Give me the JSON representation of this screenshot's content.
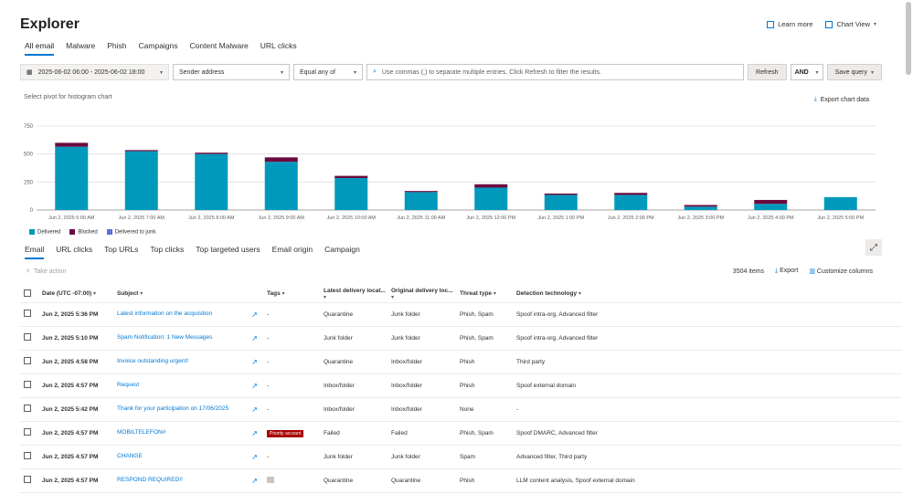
{
  "page": {
    "title": "Explorer"
  },
  "top_actions": {
    "learn_more": "Learn more",
    "chart_view": "Chart View"
  },
  "tabs": [
    "All email",
    "Malware",
    "Phish",
    "Campaigns",
    "Content Malware",
    "URL clicks"
  ],
  "filters": {
    "date_range": "2025-06-02 06:00 - 2025-06-02 18:00",
    "field": "Sender address",
    "operator": "Equal any of",
    "search_placeholder": "Use commas (,) to separate multiple entries. Click Refresh to filter the results.",
    "refresh": "Refresh",
    "logic": "AND",
    "save_query": "Save query"
  },
  "pivot_label": "Select pivot for histogram chart",
  "export_chart": "Export chart data",
  "chart_data": {
    "type": "bar",
    "stacked": true,
    "categories": [
      "Jun 2, 2025 6:00 AM",
      "Jun 2, 2025 7:00 AM",
      "Jun 2, 2025 8:00 AM",
      "Jun 2, 2025 9:00 AM",
      "Jun 2, 2025 10:00 AM",
      "Jun 2, 2025 11:00 AM",
      "Jun 2, 2025 12:00 PM",
      "Jun 2, 2025 1:00 PM",
      "Jun 2, 2025 2:00 PM",
      "Jun 2, 2025 3:00 PM",
      "Jun 2, 2025 4:00 PM",
      "Jun 2, 2025 5:00 PM"
    ],
    "series": [
      {
        "name": "Delivered",
        "color": "#0099bc",
        "values": [
          565,
          525,
          500,
          430,
          285,
          160,
          200,
          135,
          135,
          30,
          55,
          115
        ]
      },
      {
        "name": "Blocked",
        "color": "#6b0a3f",
        "values": [
          35,
          10,
          12,
          40,
          20,
          10,
          30,
          12,
          18,
          15,
          35,
          0
        ]
      },
      {
        "name": "Delivered to junk",
        "color": "#5a73d6",
        "values": [
          0,
          0,
          0,
          0,
          0,
          0,
          0,
          0,
          0,
          0,
          0,
          0
        ]
      }
    ],
    "yticks": [
      0,
      250,
      500,
      750
    ],
    "ylim": [
      0,
      750
    ]
  },
  "table_tabs": [
    "Email",
    "URL clicks",
    "Top URLs",
    "Top clicks",
    "Top targeted users",
    "Email origin",
    "Campaign"
  ],
  "take_action": "Take action",
  "table_meta": {
    "count": "3504 items",
    "export": "Export",
    "customize": "Customize columns"
  },
  "table": {
    "headers": [
      "Date (UTC -07:00)",
      "Subject",
      "Tags",
      "Latest delivery locat...",
      "Original delivery loc...",
      "Threat type",
      "Detection technology"
    ],
    "rows": [
      {
        "date": "Jun 2, 2025 5:36 PM",
        "subject": "Latest information on the acquisition",
        "tag": "-",
        "latest": "Quarantine",
        "original": "Junk folder",
        "threat": "Phish, Spam",
        "detection": "Spoof intra-org, Advanced filter"
      },
      {
        "date": "Jun 2, 2025 5:10 PM",
        "subject": "Spam Notification: 1 New Messages",
        "tag": "-",
        "latest": "Junk folder",
        "original": "Junk folder",
        "threat": "Phish, Spam",
        "detection": "Spoof intra-org, Advanced filter"
      },
      {
        "date": "Jun 2, 2025 4:58 PM",
        "subject": "Invoice outstanding urgent!",
        "tag": "-",
        "latest": "Quarantine",
        "original": "Inbox/folder",
        "threat": "Phish",
        "detection": "Third party"
      },
      {
        "date": "Jun 2, 2025 4:57 PM",
        "subject": "Request",
        "tag": "-",
        "latest": "Inbox/folder",
        "original": "Inbox/folder",
        "threat": "Phish",
        "detection": "Spoof external domain"
      },
      {
        "date": "Jun 2, 2025 5:42 PM",
        "subject": "Thank for your participation on 17/06/2025",
        "tag": "-",
        "latest": "Inbox/folder",
        "original": "Inbox/folder",
        "threat": "None",
        "detection": "-"
      },
      {
        "date": "Jun 2, 2025 4:57 PM",
        "subject": "MOBILTELEFON#",
        "tag": "Priority account",
        "latest": "Failed",
        "original": "Failed",
        "threat": "Phish, Spam",
        "detection": "Spoof DMARC, Advanced filter"
      },
      {
        "date": "Jun 2, 2025 4:57 PM",
        "subject": "CHANGE",
        "tag": "-",
        "latest": "Junk folder",
        "original": "Junk folder",
        "threat": "Spam",
        "detection": "Advanced filter, Third party"
      },
      {
        "date": "Jun 2, 2025 4:57 PM",
        "subject": "RESPOND REQUIRED!!",
        "tag": "box",
        "latest": "Quarantine",
        "original": "Quarantine",
        "threat": "Phish",
        "detection": "LLM content analysis, Spoof external domain"
      }
    ]
  }
}
